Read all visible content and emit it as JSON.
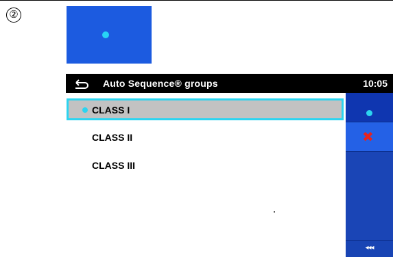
{
  "step": {
    "number": "②"
  },
  "header": {
    "title": "Auto Sequence® groups",
    "time": "10:05"
  },
  "list": {
    "items": [
      {
        "label": "CLASS I",
        "selected": true
      },
      {
        "label": "CLASS II",
        "selected": false
      },
      {
        "label": "CLASS III",
        "selected": false
      }
    ]
  },
  "sidebar": {
    "select_icon": "dot-icon",
    "cancel_icon": "close-icon",
    "back_label": "◂◂◂"
  },
  "colors": {
    "accent": "#2cd4f0",
    "sidebar": "#1c4bbe",
    "header": "#000000",
    "selected_row": "#c2c2c2",
    "cancel": "#e8221e"
  }
}
